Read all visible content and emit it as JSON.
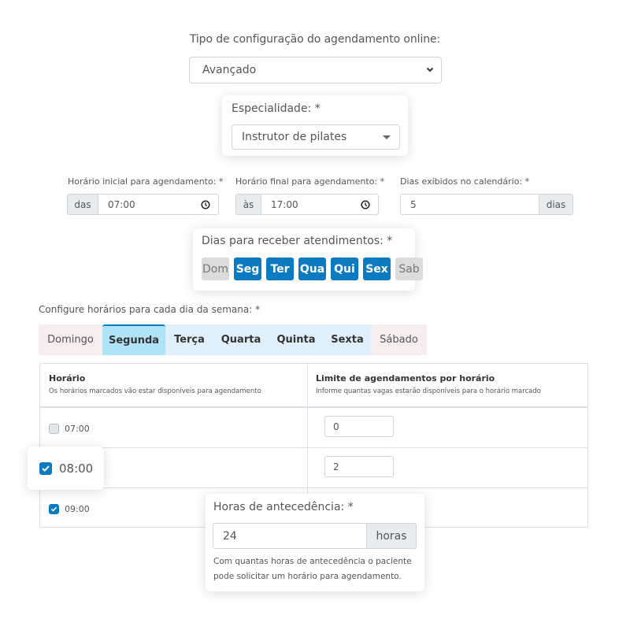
{
  "config_type": {
    "label": "Tipo de configuração do agendamento online:",
    "selected": "Avançado"
  },
  "specialty": {
    "label": "Especialidade: *",
    "selected": "Instrutor de pilates"
  },
  "start_time": {
    "label": "Horário inicial para agendamento: *",
    "prefix": "das",
    "value": "07:00"
  },
  "end_time": {
    "label": "Horário final para agendamento: *",
    "prefix": "às",
    "value": "17:00"
  },
  "calendar_days": {
    "label": "Dias exibidos no calendário: *",
    "value": "5",
    "suffix": "dias"
  },
  "service_days": {
    "label": "Dias para receber atendimentos: *",
    "days": [
      {
        "label": "Dom",
        "selected": false
      },
      {
        "label": "Seg",
        "selected": true
      },
      {
        "label": "Ter",
        "selected": true
      },
      {
        "label": "Qua",
        "selected": true
      },
      {
        "label": "Qui",
        "selected": true
      },
      {
        "label": "Sex",
        "selected": true
      },
      {
        "label": "Sab",
        "selected": false
      }
    ]
  },
  "schedule": {
    "label": "Configure horários para cada dia da semana: *",
    "tabs": [
      {
        "label": "Domingo",
        "state": "disabled"
      },
      {
        "label": "Segunda",
        "state": "active"
      },
      {
        "label": "Terça",
        "state": "enabled"
      },
      {
        "label": "Quarta",
        "state": "enabled"
      },
      {
        "label": "Quinta",
        "state": "enabled"
      },
      {
        "label": "Sexta",
        "state": "enabled"
      },
      {
        "label": "Sábado",
        "state": "disabled"
      }
    ],
    "table": {
      "col1_title": "Horário",
      "col1_subtitle": "Os horários marcados vão estar disponíveis para agendamento",
      "col2_title": "Limite de agendamentos por horário",
      "col2_subtitle": "Informe quantas vagas estarão disponíveis para o horário marcado",
      "rows": [
        {
          "time": "07:00",
          "checked": false,
          "limit": "0"
        },
        {
          "time": "08:00",
          "checked": true,
          "limit": "2"
        },
        {
          "time": "09:00",
          "checked": true,
          "limit": ""
        }
      ]
    }
  },
  "advance_hours": {
    "label": "Horas de antecedência: *",
    "value": "24",
    "suffix": "horas",
    "help": "Com quantas horas de antecedência o paciente pode solicitar um horário para agendamento."
  },
  "colors": {
    "primary": "#0b7ac0",
    "tab_active": "#aee3f8",
    "tab_enabled": "#dff0fb",
    "tab_disabled": "#f6eeee",
    "day_off": "#dcdcdc"
  }
}
